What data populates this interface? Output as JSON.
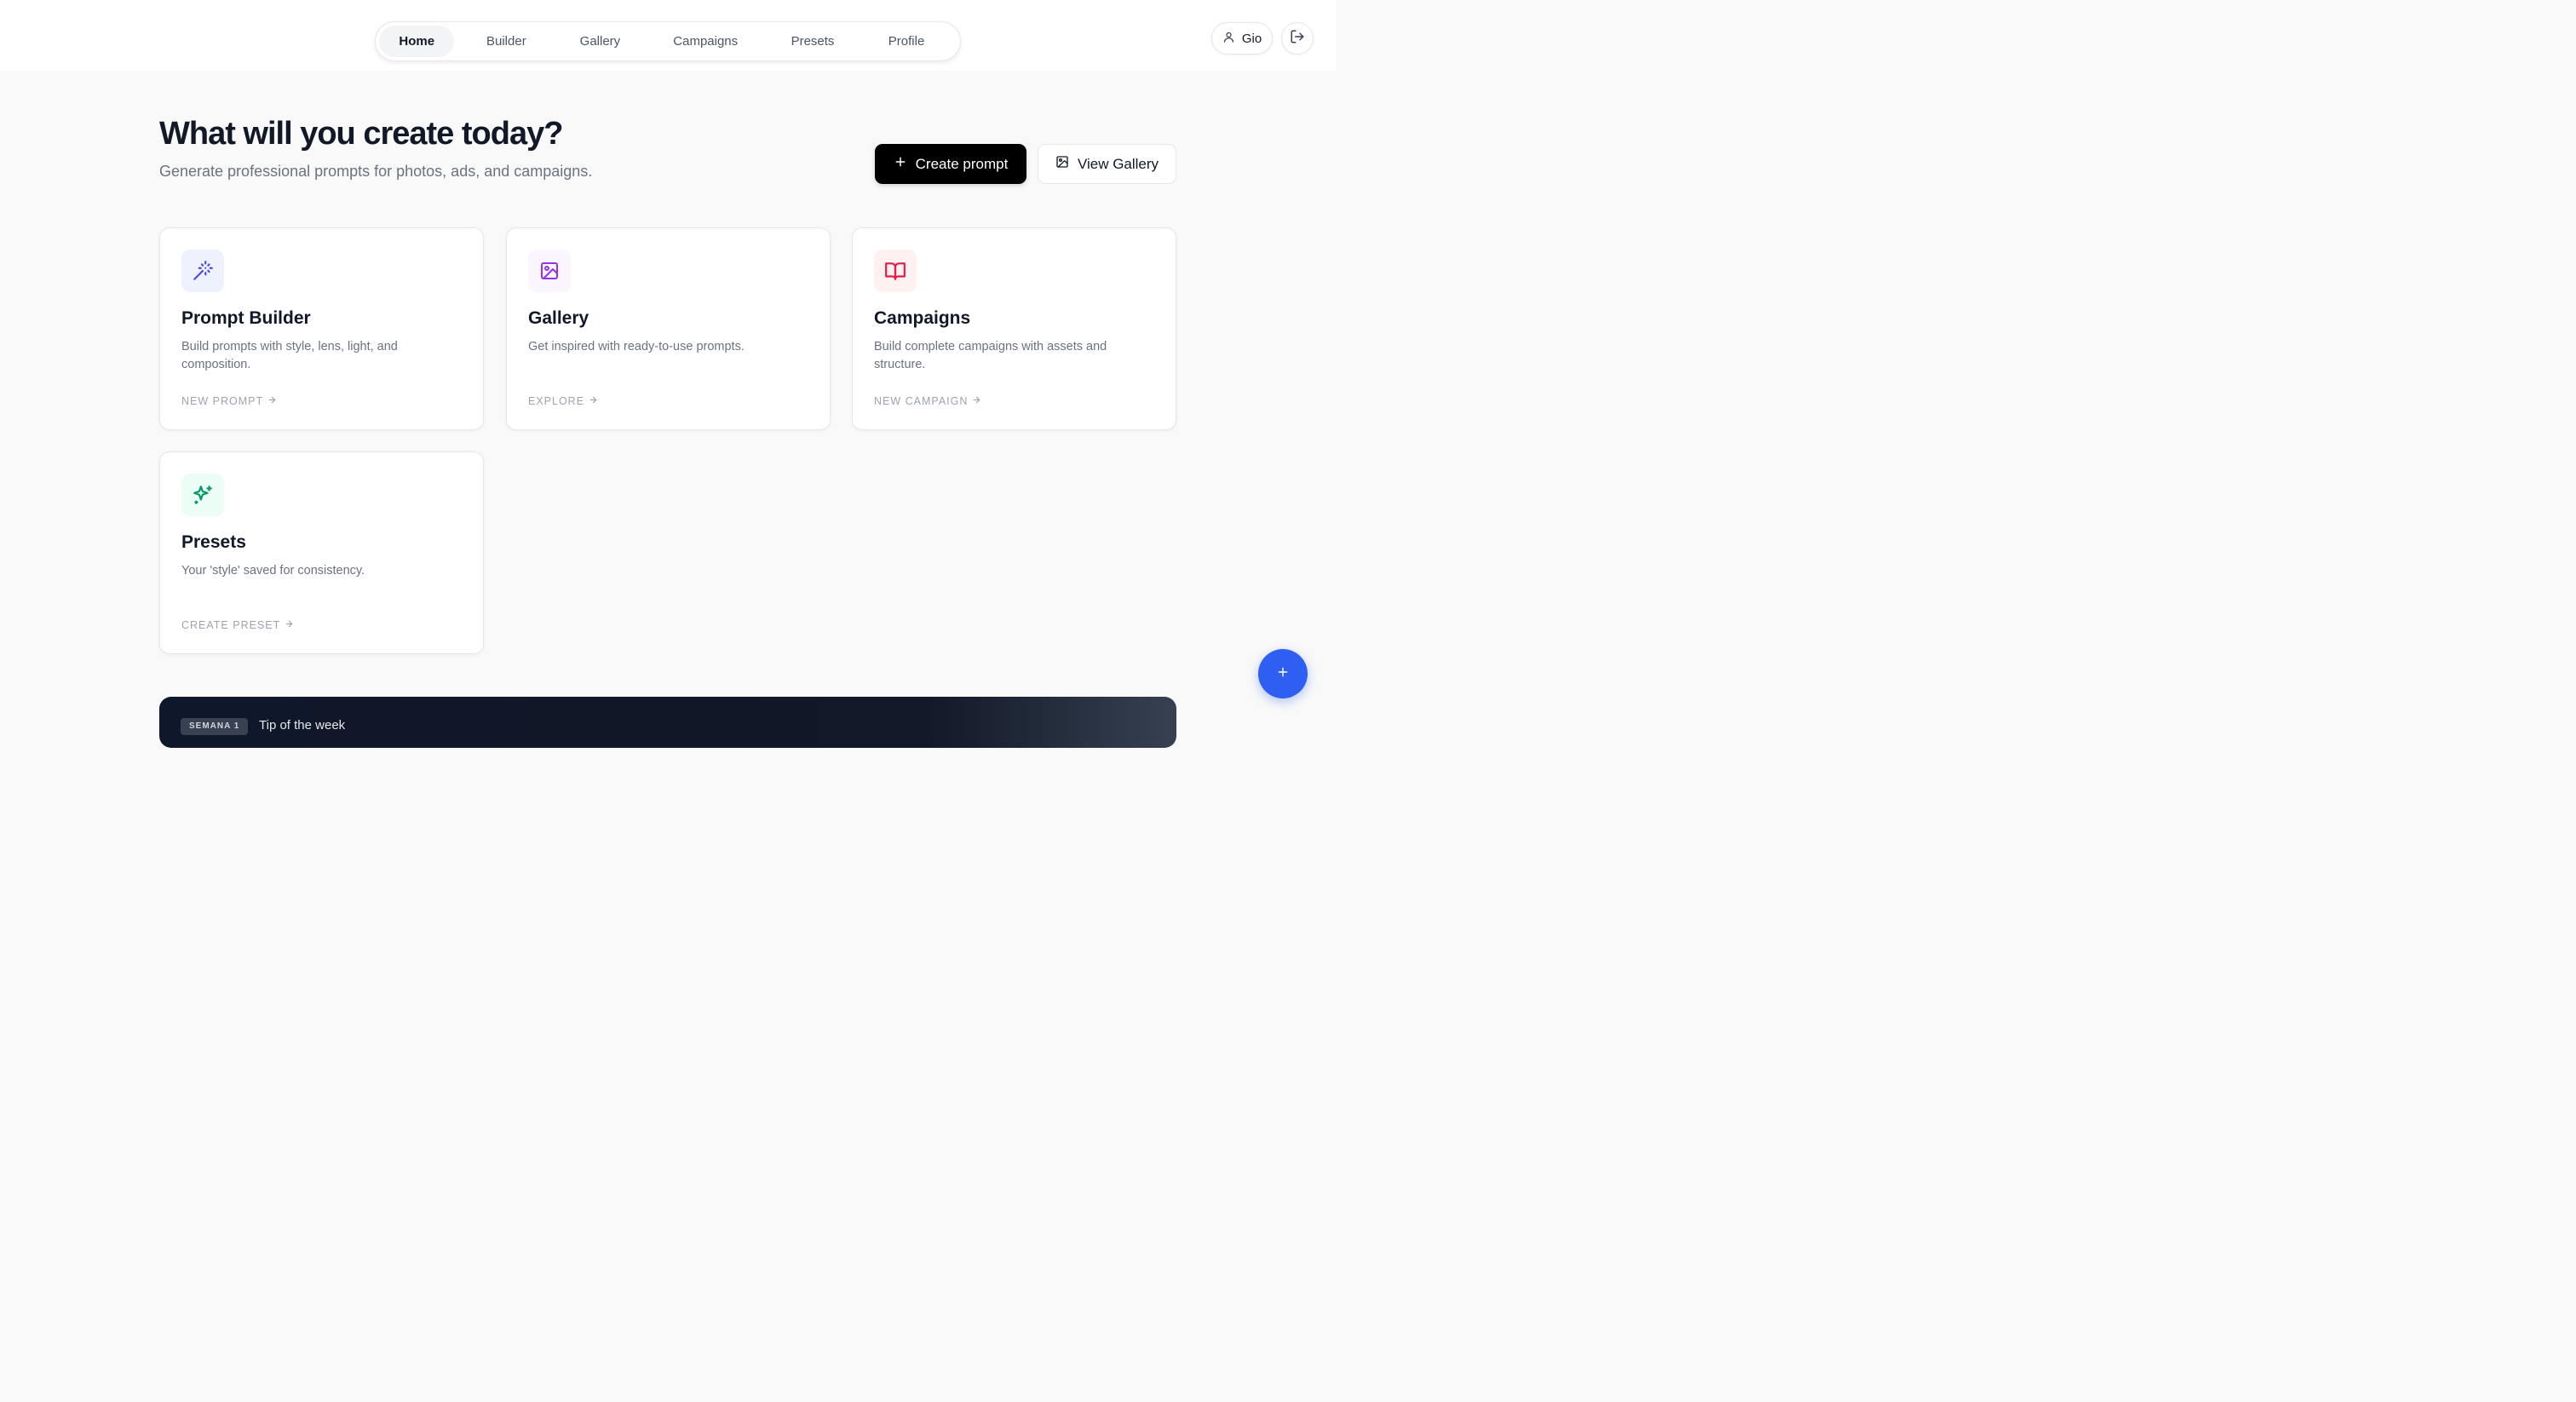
{
  "nav": {
    "items": [
      {
        "label": "Home",
        "active": true
      },
      {
        "label": "Builder",
        "active": false
      },
      {
        "label": "Gallery",
        "active": false
      },
      {
        "label": "Campaigns",
        "active": false
      },
      {
        "label": "Presets",
        "active": false
      },
      {
        "label": "Profile",
        "active": false
      }
    ]
  },
  "user": {
    "name": "Gio",
    "icon": "user-icon"
  },
  "logout": {
    "icon": "logout-icon"
  },
  "hero": {
    "title": "What will you create today?",
    "subtitle": "Generate professional prompts for photos, ads, and campaigns."
  },
  "actions": {
    "create_label": "Create prompt",
    "gallery_label": "View Gallery"
  },
  "cards": [
    {
      "title": "Prompt Builder",
      "desc": "Build prompts with style, lens, light, and composition.",
      "cta": "NEW PROMPT",
      "icon": "magic-wand-icon",
      "icon_color": "#4f46e5",
      "icon_bg": "#eef2ff"
    },
    {
      "title": "Gallery",
      "desc": "Get inspired with ready-to-use prompts.",
      "cta": "EXPLORE",
      "icon": "image-icon",
      "icon_color": "#9333ea",
      "icon_bg": "#faf5ff"
    },
    {
      "title": "Campaigns",
      "desc": "Build complete campaigns with assets and structure.",
      "cta": "NEW CAMPAIGN",
      "icon": "book-open-icon",
      "icon_color": "#e11d48",
      "icon_bg": "#fff1f2"
    },
    {
      "title": "Presets",
      "desc": "Your 'style' saved for consistency.",
      "cta": "CREATE PRESET",
      "icon": "sparkles-icon",
      "icon_color": "#059669",
      "icon_bg": "#ecfdf5"
    }
  ],
  "tip": {
    "badge": "SEMANA 1",
    "title": "Tip of the week"
  },
  "fab": {
    "icon": "plus-icon",
    "color": "#2f5ff2"
  },
  "colors": {
    "accent": "#2f5ff2",
    "primary_button": "#000000",
    "background": "#f9f9f9"
  }
}
